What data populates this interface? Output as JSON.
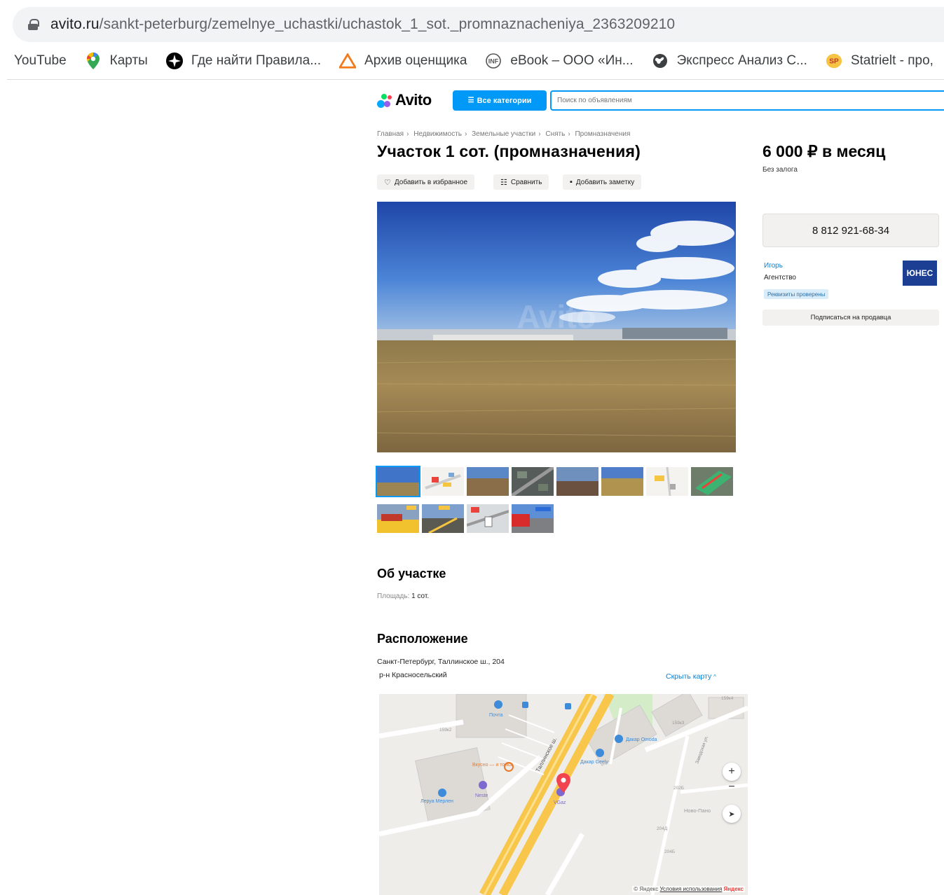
{
  "browser": {
    "url_host": "avito.ru",
    "url_path": "/sankt-peterburg/zemelnye_uchastki/uchastok_1_sot._promnaznacheniya_2363209210",
    "bookmarks": [
      {
        "label": "YouTube",
        "icon": "none"
      },
      {
        "label": "Карты",
        "icon": "google-maps-icon"
      },
      {
        "label": "Где найти Правила...",
        "icon": "compass-icon"
      },
      {
        "label": "Архив оценщика",
        "icon": "triangle-logo-icon"
      },
      {
        "label": "eBook – ООО «Ин...",
        "icon": "inf-logo-icon"
      },
      {
        "label": "Экспресс Анализ С...",
        "icon": "globe-icon"
      },
      {
        "label": "Statrielt - про,",
        "icon": "statrielt-logo-icon"
      }
    ]
  },
  "header": {
    "logo": "Avito",
    "categories_button": "Все категории",
    "search_placeholder": "Поиск по объявлениям"
  },
  "breadcrumbs": [
    "Главная",
    "Недвижимость",
    "Земельные участки",
    "Снять",
    "Промназначения"
  ],
  "listing": {
    "title": "Участок 1 сот. (промназначения)",
    "price": "6 000 ₽ в месяц",
    "deposit": "Без залога",
    "actions": {
      "favorite": "Добавить в избранное",
      "compare": "Сравнить",
      "note": "Добавить заметку"
    },
    "thumbnail_count": 12
  },
  "seller": {
    "phone": "8 812 921-68-34",
    "name": "Игорь",
    "type": "Агентство",
    "verified_badge": "Реквизиты проверены",
    "agency_logo": "ЮНЕС",
    "subscribe": "Подписаться на продавца"
  },
  "about": {
    "heading": "Об участке",
    "area_label": "Площадь:",
    "area_value": "1 сот."
  },
  "location": {
    "heading": "Расположение",
    "address": "Санкт-Петербург, Таллинское ш., 204",
    "district": "р-н Красносельский",
    "hide_map": "Скрыть карту",
    "map_labels": {
      "road": "Таллинское ш.",
      "pochta": "Почта",
      "vkusno": "Вкусно — и точка",
      "neste": "Neste",
      "leroy": "Леруа Мерлен",
      "vgaz": "VGaz",
      "dakar_omoda": "Дакар Omoda",
      "dakar_geely": "Дакар Geely",
      "b159k2": "159к2",
      "b159k4": "159к4",
      "b159k3": "159к3",
      "b202b": "202Б",
      "b204d": "204Д",
      "b204b": "204Б",
      "novo": "Ново-Пано",
      "street": "Заводская ул."
    },
    "map_footer": {
      "brand": "© Яндекс",
      "terms": "Условия использования",
      "logo": "Яндекс"
    }
  },
  "colors": {
    "avito_blue": "#0099f7",
    "link_blue": "#0a80d5",
    "button_gray": "#f2f1f0",
    "map_marker": "#f2444f",
    "agency_blue": "#1c3f94"
  }
}
